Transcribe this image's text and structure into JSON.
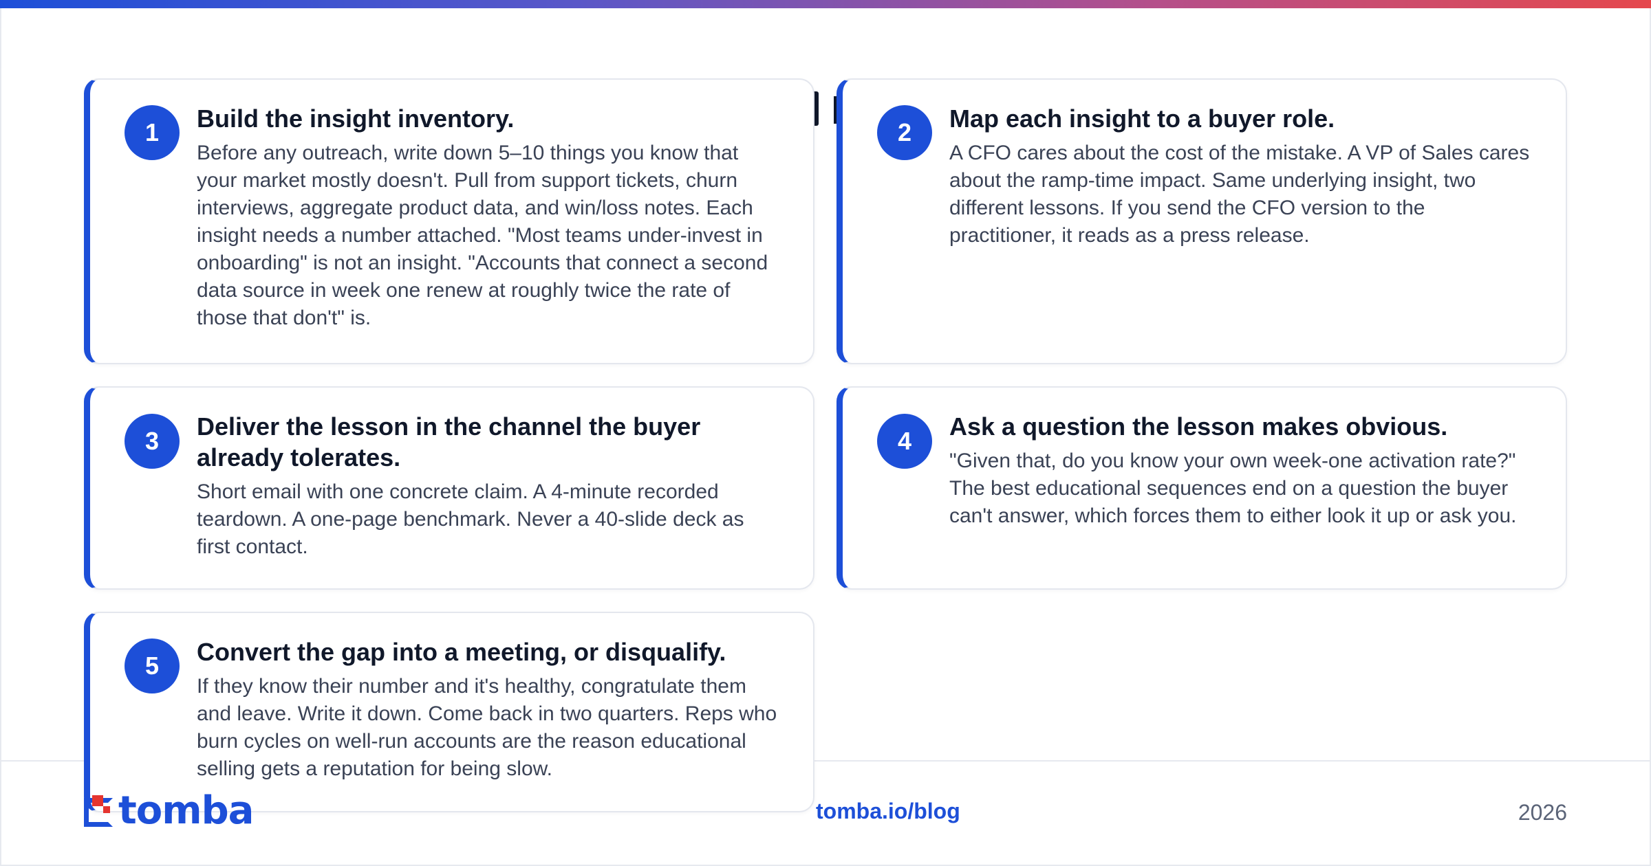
{
  "steps": [
    {
      "number": "1",
      "title": "Build the insight inventory.",
      "text": "Before any outreach, write down 5–10 things you know that your market mostly doesn't. Pull from support tickets, churn interviews, aggregate product data, and win/loss notes. Each insight needs a number attached. \"Most teams under-invest in onboarding\" is not an insight. \"Accounts that connect a second data source in week one renew at roughly twice the rate of those that don't\" is."
    },
    {
      "number": "2",
      "title": "Map each insight to a buyer role.",
      "text": "A CFO cares about the cost of the mistake. A VP of Sales cares about the ramp-time impact. Same underlying insight, two different lessons. If you send the CFO version to the practitioner, it reads as a press release."
    },
    {
      "number": "3",
      "title": "Deliver the lesson in the channel the buyer already tolerates.",
      "text": "Short email with one concrete claim. A 4-minute recorded teardown. A one-page benchmark. Never a 40-slide deck as first contact."
    },
    {
      "number": "4",
      "title": "Ask a question the lesson makes obvious.",
      "text": "\"Given that, do you know your own week-one activation rate?\" The best educational sequences end on a question the buyer can't answer, which forces them to either look it up or ask you."
    },
    {
      "number": "5",
      "title": "Convert the gap into a meeting, or disqualify.",
      "text": "If they know their number and it's healthy, congratulate them and leave. Write it down. Come back in two quarters. Reps who burn cycles on well-run accounts are the reason educational selling gets a reputation for being slow."
    }
  ],
  "footer": {
    "logo_text": "tomba",
    "link": "tomba.io/blog",
    "year": "2026"
  },
  "colors": {
    "accent": "#1d4fd8",
    "brand_red": "#e5342f",
    "gradient": [
      "#1d4fd8",
      "#5a57c8",
      "#b54f8a",
      "#e5484d"
    ]
  },
  "icons": [
    "tomba-logo-icon"
  ]
}
